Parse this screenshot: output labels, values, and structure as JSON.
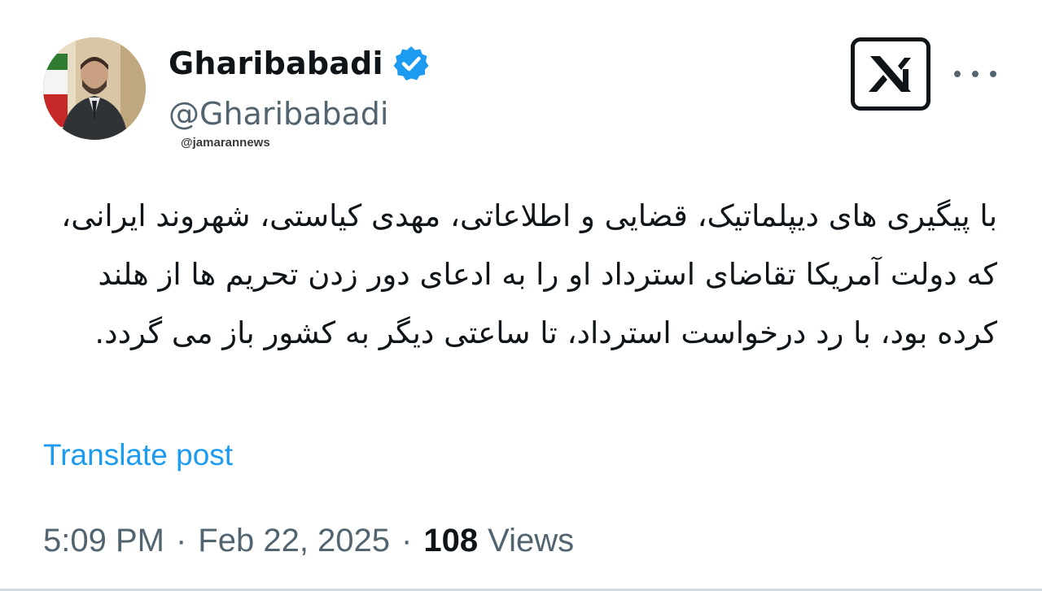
{
  "author": {
    "display_name": "Gharibabadi",
    "handle": "@Gharibabadi",
    "verified": true,
    "avatar_icon": "profile-photo"
  },
  "watermark": "@jamarannews",
  "platform_logo": "x-logo-icon",
  "tweet": {
    "text": "با پیگیری های دیپلماتیک، قضایی و اطلاعاتی، مهدی کیاستی، شهروند ایرانی، که دولت آمریکا تقاضای استرداد او را به ادعای دور زدن تحریم ها از هلند کرده بود، با رد درخواست استرداد، تا ساعتی دیگر به کشور باز می گردد.",
    "translate_label": "Translate post"
  },
  "meta": {
    "time": "5:09 PM",
    "separator": "·",
    "date": "Feb 22, 2025",
    "views_count": "108",
    "views_label": "Views"
  },
  "colors": {
    "text_primary": "#0f1419",
    "text_secondary": "#536471",
    "accent": "#1d9bf0",
    "verified": "#1d9bf0"
  }
}
